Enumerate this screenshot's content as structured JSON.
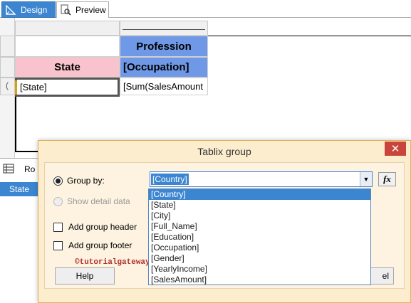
{
  "tabs": {
    "design": "Design",
    "preview": "Preview"
  },
  "tablix": {
    "column_group_header": "Profession",
    "row_group_header": "State",
    "column_field": "[Occupation]",
    "row_field": "[State]",
    "data_field": "[Sum(SalesAmount",
    "row_marker": "("
  },
  "row_groups": {
    "title": "Ro",
    "item": "State"
  },
  "dialog": {
    "title": "Tablix group",
    "close": "✕",
    "group_by_label": "Group by:",
    "group_by_value": "[Country]",
    "show_detail_label": "Show detail data",
    "add_header_label": "Add group header",
    "add_footer_label": "Add group footer",
    "fx_label": "fx",
    "help_label": "Help",
    "cancel_label": "el",
    "options": [
      "[Country]",
      "[State]",
      "[City]",
      "[Full_Name]",
      "[Education]",
      "[Occupation]",
      "[Gender]",
      "[YearlyIncome]",
      "[SalesAmount]"
    ]
  },
  "watermark": "©tutorialgateway.org",
  "colors": {
    "accent": "#3c86d1",
    "row_header": "#f8c3cd",
    "col_header": "#6f98e6",
    "dialog_bg": "#fcedcf",
    "close": "#c9443a"
  }
}
